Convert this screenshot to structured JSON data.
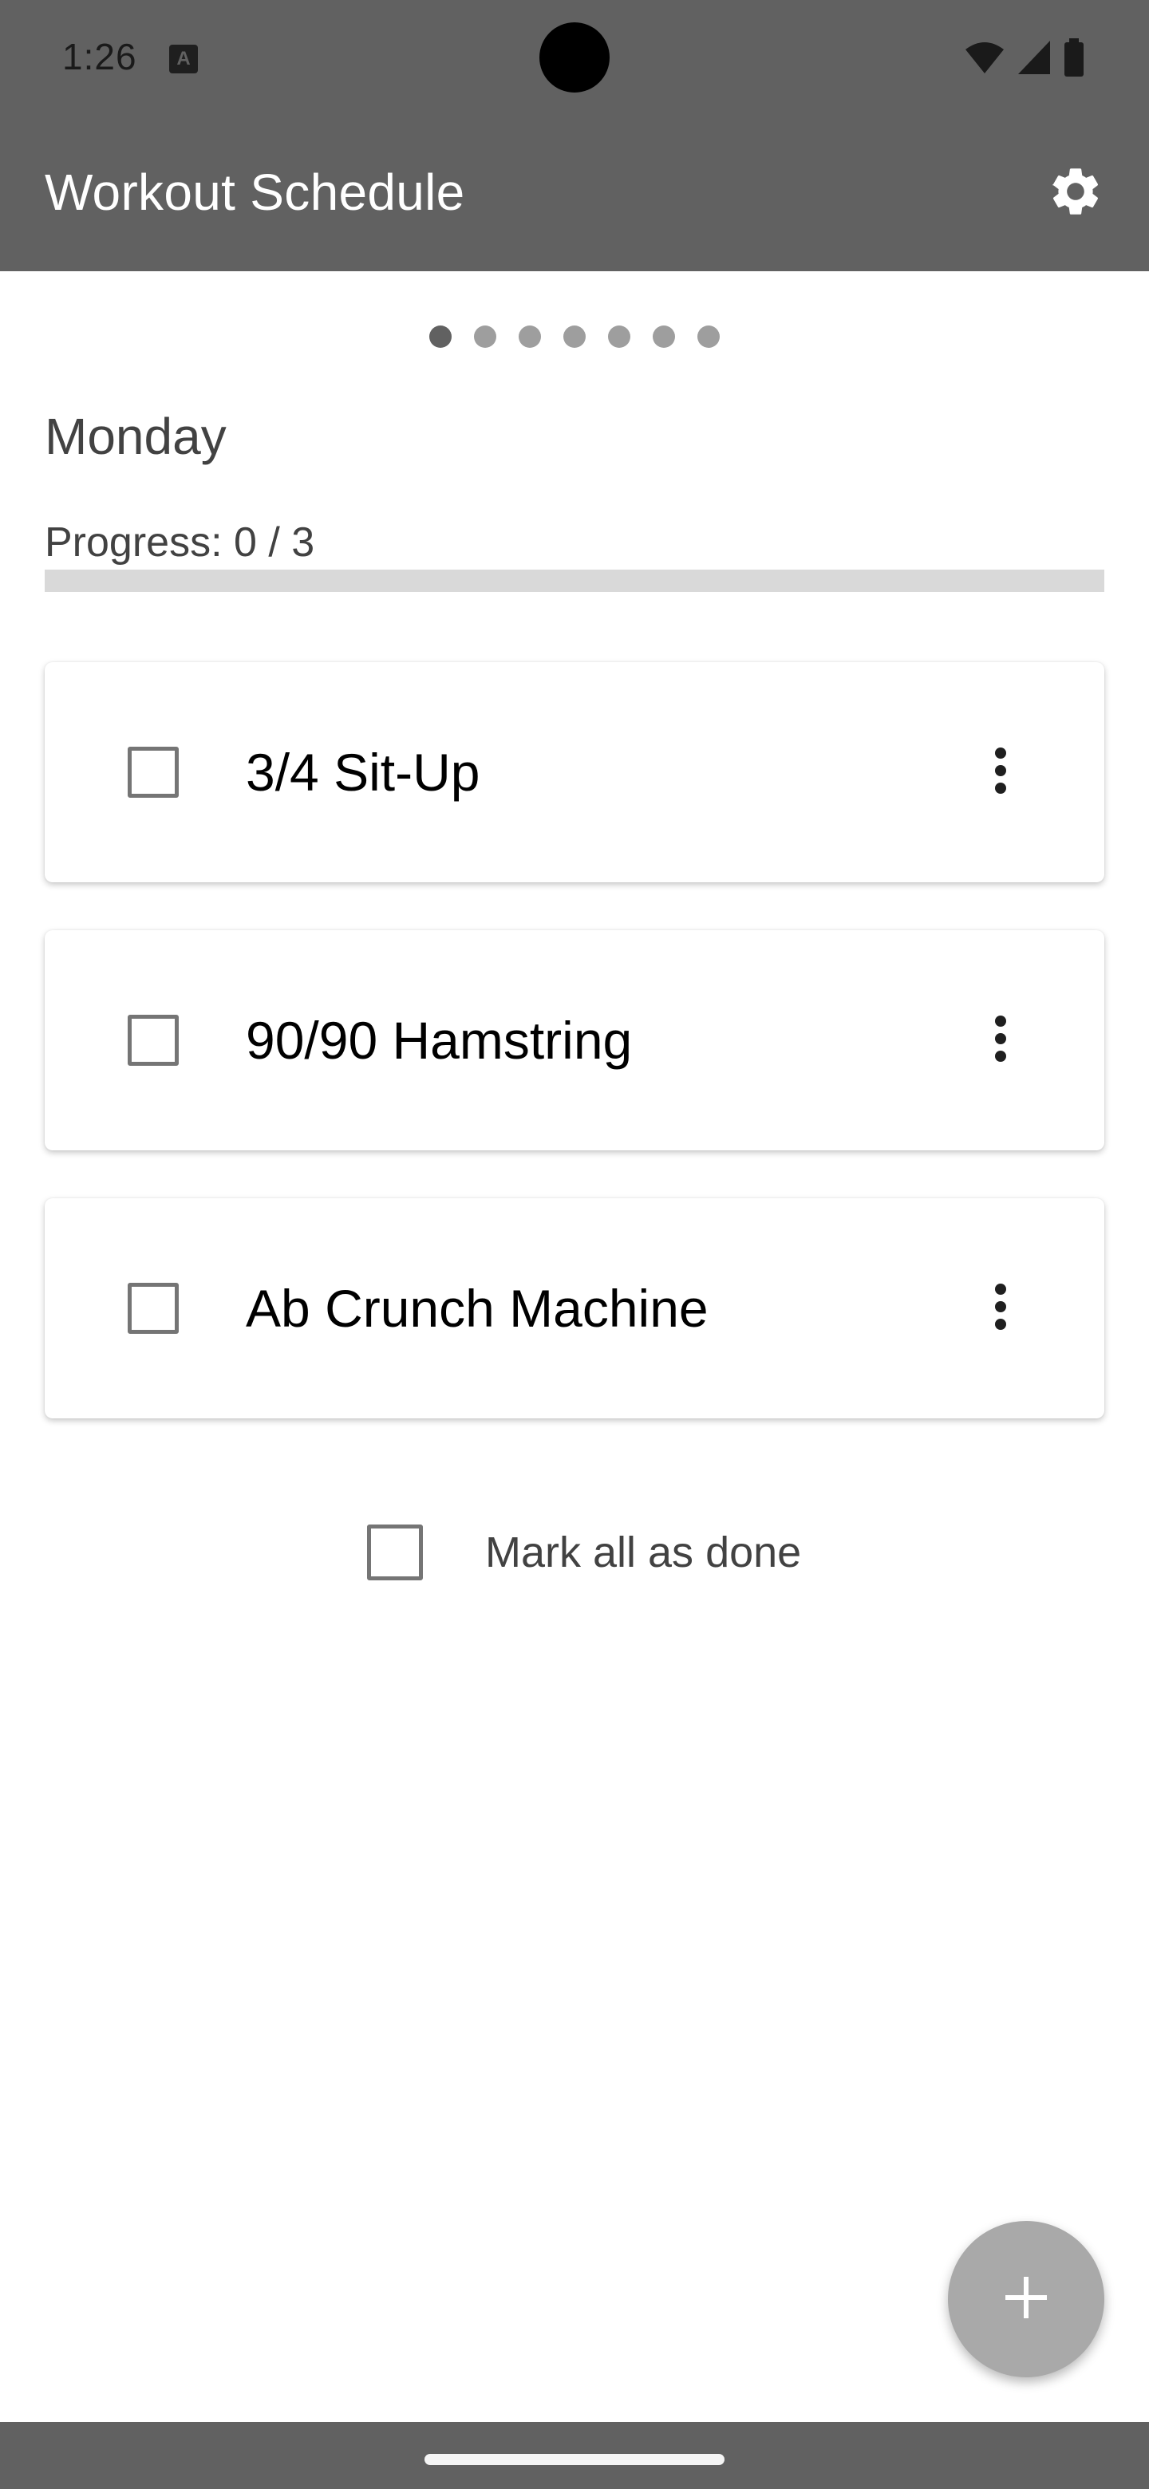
{
  "status_bar": {
    "time": "1:26",
    "a_icon_glyph": "A",
    "icons": [
      "a-icon",
      "wifi-icon",
      "signal-icon",
      "battery-icon"
    ]
  },
  "app_bar": {
    "title": "Workout Schedule",
    "settings_icon": "gear-icon"
  },
  "pager": {
    "page_count": 7,
    "active_index": 0
  },
  "day": {
    "title": "Monday",
    "progress_label": "Progress: 0 / 3",
    "progress_fraction": 0
  },
  "exercises": [
    {
      "name": "3/4 Sit-Up",
      "checked": false
    },
    {
      "name": "90/90 Hamstring",
      "checked": false
    },
    {
      "name": "Ab Crunch Machine",
      "checked": false
    }
  ],
  "mark_all": {
    "label": "Mark all as done",
    "checked": false
  },
  "fab": {
    "icon": "plus-icon"
  },
  "colors": {
    "app_bar": "#616161",
    "dot_active": "#616161",
    "dot_inactive": "#9e9e9e",
    "fab": "#a9a9a9",
    "progress_track": "#d9d9d9"
  }
}
